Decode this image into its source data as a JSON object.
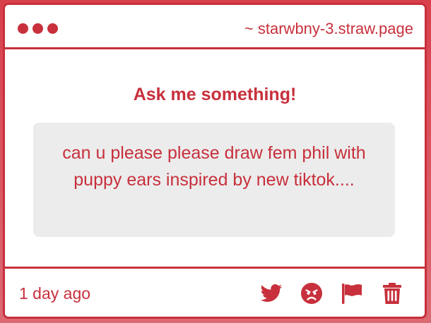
{
  "window": {
    "url": "~ starwbny-3.straw.page"
  },
  "main": {
    "heading": "Ask me something!",
    "question": "can u please please draw fem phil with puppy ears inspired by new tiktok...."
  },
  "footer": {
    "timestamp": "1 day ago",
    "actions": [
      {
        "icon": "twitter-icon"
      },
      {
        "icon": "angry-face-icon"
      },
      {
        "icon": "flag-icon"
      },
      {
        "icon": "trash-icon"
      }
    ]
  },
  "colors": {
    "accent": "#c7303c",
    "background": "#ffffff",
    "question_box": "#ececec"
  }
}
